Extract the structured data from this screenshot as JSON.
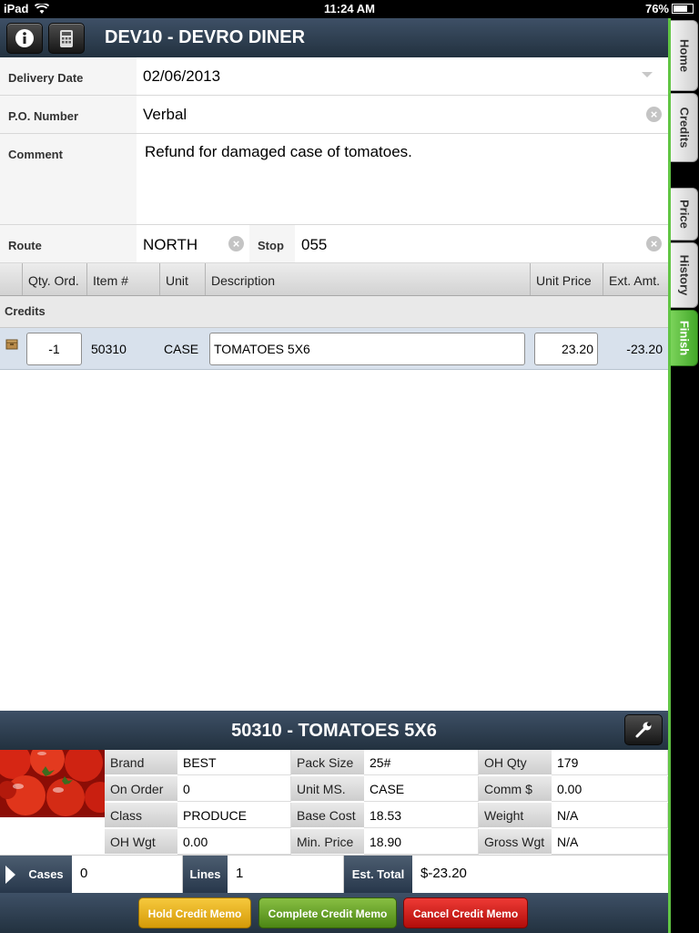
{
  "status": {
    "carrier": "iPad",
    "time": "11:24 AM",
    "battery": "76%"
  },
  "header": {
    "title": "DEV10 - DEVRO DINER",
    "info_icon": "info-icon",
    "calc_icon": "calculator-icon"
  },
  "form": {
    "delivery_date_label": "Delivery Date",
    "delivery_date": "02/06/2013",
    "po_label": "P.O. Number",
    "po": "Verbal",
    "comment_label": "Comment",
    "comment": "Refund for damaged case of tomatoes.",
    "route_label": "Route",
    "route": "NORTH",
    "stop_label": "Stop",
    "stop": "055"
  },
  "table": {
    "headers": {
      "qty": "Qty. Ord.",
      "item": "Item #",
      "unit": "Unit",
      "desc": "Description",
      "price": "Unit Price",
      "ext": "Ext. Amt."
    },
    "group_label": "Credits",
    "rows": [
      {
        "qty": "-1",
        "item": "50310",
        "unit": "CASE",
        "desc": "TOMATOES 5X6",
        "price": "23.20",
        "ext": "-23.20"
      }
    ]
  },
  "detail": {
    "title": "50310 - TOMATOES 5X6",
    "fields": {
      "brand_label": "Brand",
      "brand": "BEST",
      "on_order_label": "On Order",
      "on_order": "0",
      "class_label": "Class",
      "class": "PRODUCE",
      "oh_wgt_label": "OH Wgt",
      "oh_wgt": "0.00",
      "pack_size_label": "Pack Size",
      "pack_size": "25#",
      "unit_ms_label": "Unit MS.",
      "unit_ms": "CASE",
      "base_cost_label": "Base Cost",
      "base_cost": "18.53",
      "min_price_label": "Min. Price",
      "min_price": "18.90",
      "oh_qty_label": "OH Qty",
      "oh_qty": "179",
      "comm_label": "Comm $",
      "comm": "0.00",
      "weight_label": "Weight",
      "weight": "N/A",
      "gross_wgt_label": "Gross Wgt",
      "gross_wgt": "N/A"
    }
  },
  "summary": {
    "cases_label": "Cases",
    "cases": "0",
    "lines_label": "Lines",
    "lines": "1",
    "est_total_label": "Est. Total",
    "est_total": "$-23.20"
  },
  "actions": {
    "hold": "Hold Credit Memo",
    "complete": "Complete Credit Memo",
    "cancel": "Cancel Credit Memo"
  },
  "side_tabs": {
    "home": "Home",
    "credits": "Credits",
    "price": "Price",
    "history": "History",
    "finish": "Finish"
  },
  "colors": {
    "header": "#2c3c4e",
    "accent_green": "#61c544",
    "hold": "#e8b21e",
    "complete": "#6aa52c",
    "cancel": "#d11f1c",
    "row_highlight": "#d8e1ec"
  }
}
